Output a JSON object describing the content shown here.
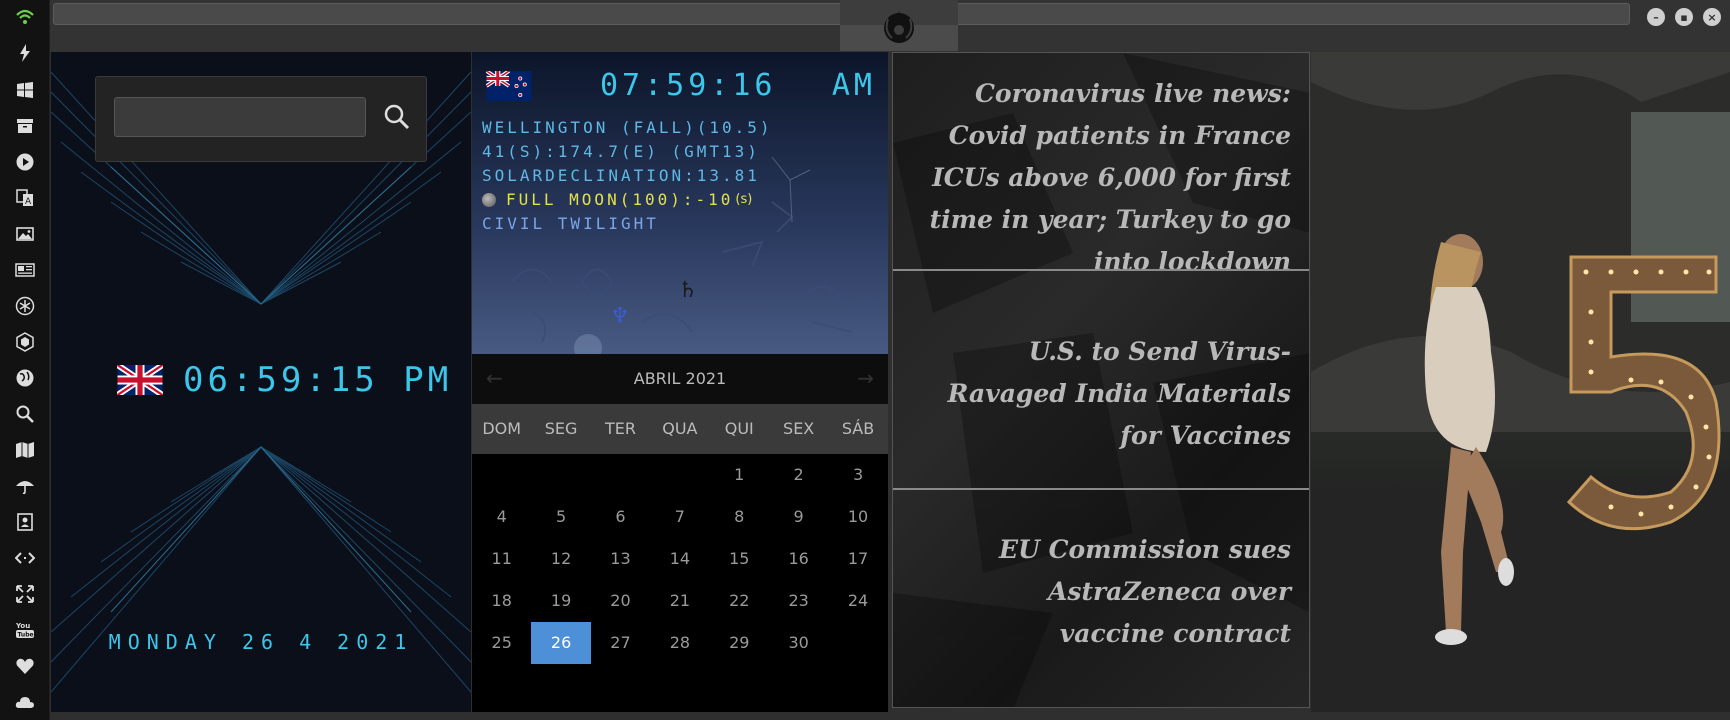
{
  "colors": {
    "accent": "#3cc6ea",
    "calendar_today": "#4e90d8",
    "moon_text": "#e3e14a",
    "wifi": "#6cd04a"
  },
  "sidebar": {
    "items": [
      {
        "icon": "wifi-icon"
      },
      {
        "icon": "lightning-icon"
      },
      {
        "icon": "windows-icon"
      },
      {
        "icon": "archive-icon"
      },
      {
        "icon": "play-icon"
      },
      {
        "icon": "translate-icon"
      },
      {
        "icon": "image-icon"
      },
      {
        "icon": "news-icon"
      },
      {
        "icon": "snowflake-icon"
      },
      {
        "icon": "hexagon-icon"
      },
      {
        "icon": "globe-icon"
      },
      {
        "icon": "search-icon"
      },
      {
        "icon": "map-icon"
      },
      {
        "icon": "umbrella-icon"
      },
      {
        "icon": "contacts-icon"
      },
      {
        "icon": "code-icon"
      },
      {
        "icon": "expand-icon"
      },
      {
        "icon": "youtube-icon"
      },
      {
        "icon": "heart-icon"
      },
      {
        "icon": "cloud-icon"
      }
    ]
  },
  "topbar": {
    "logo_icon": "rebel-alliance-icon"
  },
  "search": {
    "value": "",
    "placeholder": ""
  },
  "uk_clock": {
    "flag": "uk-flag-icon",
    "time": "06:59:15 PM",
    "date": "MONDAY 26 4 2021"
  },
  "nz_clock": {
    "flag": "nz-flag-icon",
    "time": "07:59:16",
    "ampm": "AM",
    "city": "WELLINGTON (FALL)(10.5)",
    "coords": "41(S):174.7(E) (GMT13)",
    "solar": "SOLARDECLINATION:13.81",
    "moon": "FULL MOON(100):-10",
    "moon_suffix": "(s)",
    "twilight": "CIVIL TWILIGHT",
    "saturn": "♄",
    "neptune": "♆"
  },
  "calendar": {
    "title": "ABRIL 2021",
    "prev": "←",
    "next": "→",
    "weekdays": [
      "DOM",
      "SEG",
      "TER",
      "QUA",
      "QUI",
      "SEX",
      "SÁB"
    ],
    "weeks": [
      [
        "",
        "",
        "",
        "",
        "1",
        "2",
        "3"
      ],
      [
        "4",
        "5",
        "6",
        "7",
        "8",
        "9",
        "10"
      ],
      [
        "11",
        "12",
        "13",
        "14",
        "15",
        "16",
        "17"
      ],
      [
        "18",
        "19",
        "20",
        "21",
        "22",
        "23",
        "24"
      ],
      [
        "25",
        "26",
        "27",
        "28",
        "29",
        "30",
        ""
      ]
    ],
    "today": "26"
  },
  "news": {
    "headlines": [
      "Coronavirus live news: Covid patients in France ICUs above 6,000 for first time in year; Turkey to go into lockdown",
      "U.S. to Send Virus-Ravaged India Materials for Vaccines",
      "EU Commission sues AstraZeneca over vaccine contract"
    ]
  },
  "photo": {
    "large_number": "5"
  }
}
